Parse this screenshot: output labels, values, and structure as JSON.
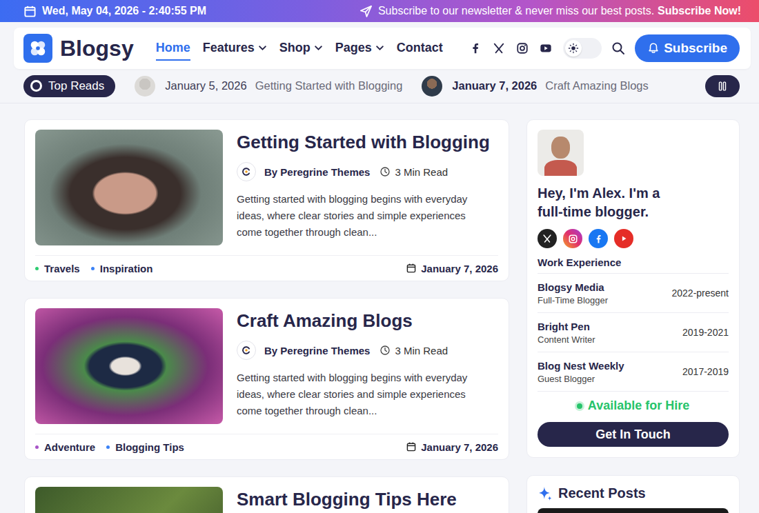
{
  "topbar": {
    "datetime": "Wed, May 04, 2026 - 2:40:55 PM",
    "message": "Subscribe to our newsletter & never miss our best posts.",
    "cta": "Subscribe Now!"
  },
  "header": {
    "logo": "Blogsy",
    "nav": [
      {
        "label": "Home",
        "selected": true,
        "has_menu": false
      },
      {
        "label": "Features",
        "selected": false,
        "has_menu": true
      },
      {
        "label": "Shop",
        "selected": false,
        "has_menu": true
      },
      {
        "label": "Pages",
        "selected": false,
        "has_menu": true
      },
      {
        "label": "Contact",
        "selected": false,
        "has_menu": false
      }
    ],
    "dark_mode": false,
    "subscribe": "Subscribe"
  },
  "ticker": {
    "label": "Top Reads",
    "playing": true,
    "items": [
      {
        "date": "January 5, 2026",
        "title": "Getting Started with Blogging"
      },
      {
        "date": "January 7, 2026",
        "title": "Craft Amazing Blogs"
      }
    ]
  },
  "posts": [
    {
      "title": "Getting Started with Blogging",
      "author": "By Peregrine Themes",
      "read_time": "3 Min Read",
      "excerpt": "Getting started with blogging begins with everyday ideas, where clear stories and simple experiences come together through clean...",
      "tags": [
        {
          "label": "Travels",
          "color": "#2ecc71"
        },
        {
          "label": "Inspiration",
          "color": "#3b82f6"
        }
      ],
      "date": "January 7, 2026"
    },
    {
      "title": "Craft Amazing Blogs",
      "author": "By Peregrine Themes",
      "read_time": "3 Min Read",
      "excerpt": "Getting started with blogging begins with everyday ideas, where clear stories and simple experiences come together through clean...",
      "tags": [
        {
          "label": "Adventure",
          "color": "#a855c7"
        },
        {
          "label": "Blogging Tips",
          "color": "#3b82f6"
        }
      ],
      "date": "January 7, 2026"
    },
    {
      "title": "Smart Blogging Tips Here"
    }
  ],
  "profile": {
    "greeting": "Hey, I'm Alex. I'm a full-time blogger.",
    "experience_title": "Work Experience",
    "experience": [
      {
        "company": "Blogsy Media",
        "role": "Full-Time Blogger",
        "period": "2022-present"
      },
      {
        "company": "Bright Pen",
        "role": "Content Writer",
        "period": "2019-2021"
      },
      {
        "company": "Blog Nest Weekly",
        "role": "Guest Blogger",
        "period": "2017-2019"
      }
    ],
    "availability": "Available for Hire",
    "button": "Get In Touch"
  },
  "recent_posts": {
    "title": "Recent Posts"
  }
}
